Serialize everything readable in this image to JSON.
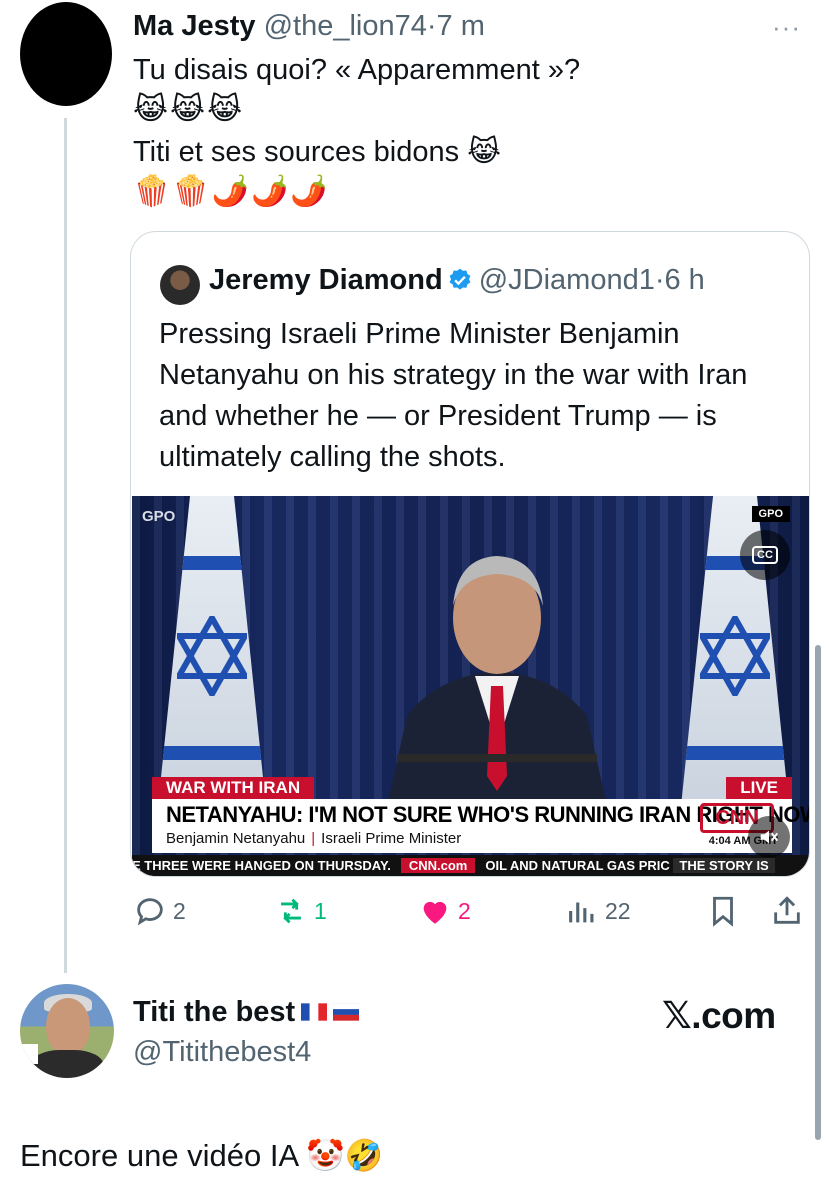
{
  "tweet": {
    "author_name": "Ma Jesty",
    "handle": "@the_lion74",
    "separator": "·",
    "time": "7 m",
    "more_icon": "···",
    "lines": [
      "Tu disais quoi?  « Apparemment »?",
      "😹😹😹",
      "Titi et ses sources bidons 😹",
      "🍿🍿🌶️🌶️🌶️"
    ]
  },
  "quote": {
    "author_name": "Jeremy Diamond",
    "handle": "@JDiamond1",
    "separator": "·",
    "time": "6 h",
    "text": "Pressing Israeli Prime Minister Benjamin Netanyahu on his strategy in the war with Iran and whether he — or President Trump — is ultimately calling the shots.",
    "video": {
      "gpo_logo": "GPO",
      "gpo_tag": "GPO",
      "cc_label": "CC",
      "chyron_top": "WAR WITH IRAN",
      "live": "LIVE",
      "headline": "NETANYAHU: I'M NOT SURE WHO'S RUNNING IRAN RIGHT NOW",
      "speaker": "Benjamin Netanyahu",
      "speaker_title": "Israeli Prime Minister",
      "network": "CNN",
      "clock": "4:04 AM GMT",
      "ticker_left": "E THREE WERE HANGED ON THURSDAY.",
      "ticker_site": "CNN.com",
      "ticker_right": "OIL AND NATURAL GAS PRIC",
      "ticker_story": "THE STORY IS"
    }
  },
  "actions": {
    "replies": "2",
    "reposts": "1",
    "likes": "2",
    "views": "22"
  },
  "reply": {
    "author_name": "Titi the best",
    "handle": "@Titithebest4",
    "watermark": "𝕏.com",
    "text": "Encore une vidéo IA 🤡🤣"
  },
  "colors": {
    "text": "#0f1419",
    "secondary": "#536471",
    "repost": "#00ba7c",
    "like": "#f91880",
    "verified": "#1d9bf0",
    "cnn_red": "#c8102e"
  }
}
